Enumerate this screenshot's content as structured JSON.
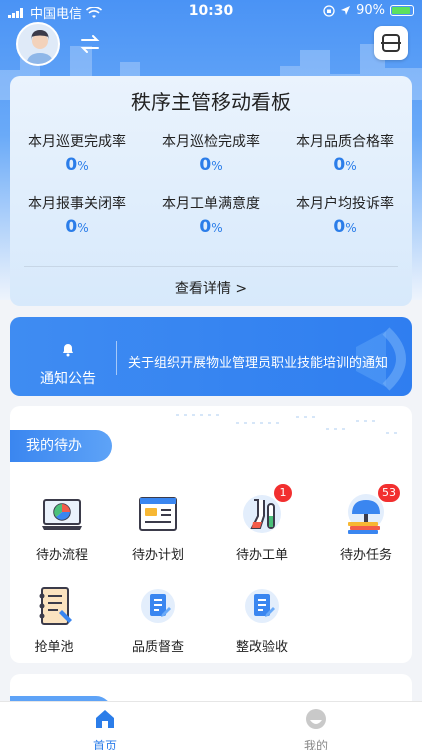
{
  "status_bar": {
    "carrier": "中国电信",
    "time": "10:30",
    "battery": "90%",
    "battery_level": 0.9
  },
  "dashboard": {
    "title": "秩序主管移动看板",
    "metrics": [
      {
        "label": "本月巡更完成率",
        "value": "0",
        "unit": "%"
      },
      {
        "label": "本月巡检完成率",
        "value": "0",
        "unit": "%"
      },
      {
        "label": "本月品质合格率",
        "value": "0",
        "unit": "%"
      },
      {
        "label": "本月报事关闭率",
        "value": "0",
        "unit": "%"
      },
      {
        "label": "本月工单满意度",
        "value": "0",
        "unit": "%"
      },
      {
        "label": "本月户均投诉率",
        "value": "0",
        "unit": "%"
      }
    ],
    "detail_link": "查看详情 >"
  },
  "notice": {
    "label": "通知公告",
    "text": "关于组织开展物业管理员职业技能培训的通知"
  },
  "todo": {
    "title": "我的待办",
    "items": [
      {
        "label": "待办流程",
        "icon": "workflow-icon"
      },
      {
        "label": "待办计划",
        "icon": "plan-icon"
      },
      {
        "label": "待办工单",
        "icon": "work-order-icon",
        "badge": "1"
      },
      {
        "label": "待办任务",
        "icon": "task-icon",
        "badge": "53"
      },
      {
        "label": "抢单池",
        "icon": "order-pool-icon"
      },
      {
        "label": "品质督查",
        "icon": "quality-inspection-icon"
      },
      {
        "label": "整改验收",
        "icon": "rectification-icon"
      }
    ]
  },
  "tabbar": {
    "tabs": [
      {
        "label": "首页",
        "icon": "home-icon",
        "active": true
      },
      {
        "label": "我的",
        "icon": "profile-icon",
        "active": false
      }
    ]
  },
  "colors": {
    "primary": "#2b7de9",
    "badge": "#f22f2f",
    "tab_active": "#2b7de9",
    "tab_inactive": "#888888"
  }
}
